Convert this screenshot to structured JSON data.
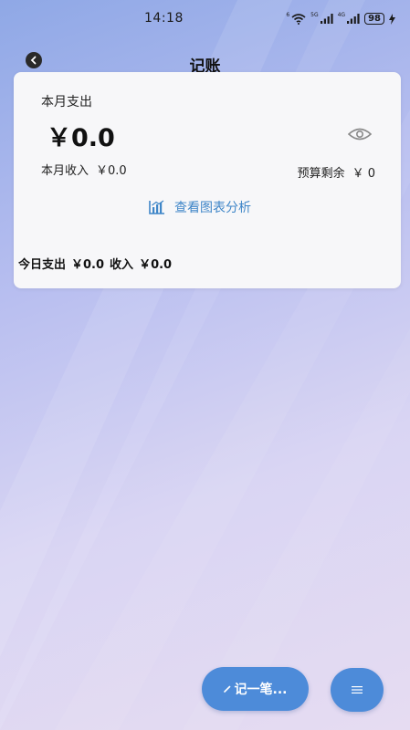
{
  "status_bar": {
    "time": "14:18",
    "signal1_label": "5G",
    "signal2_label": "4G",
    "wifi_label": "6",
    "battery": "98"
  },
  "header": {
    "title": "记账"
  },
  "summary": {
    "month_expense_label": "本月支出",
    "month_expense_amount": "￥0.0",
    "month_income_label": "本月收入",
    "month_income_amount": "￥0.0",
    "budget_label": "预算剩余",
    "budget_amount": "￥ 0",
    "chart_link": "查看图表分析",
    "today_expense_label": "今日支出",
    "today_expense_amount": "￥0.0",
    "today_income_label": "收入",
    "today_income_amount": "￥0.0"
  },
  "actions": {
    "add_record_label": "记一笔...",
    "menu_label": "≡"
  },
  "colors": {
    "accent": "#4d8bd9",
    "link": "#3f86c8"
  }
}
